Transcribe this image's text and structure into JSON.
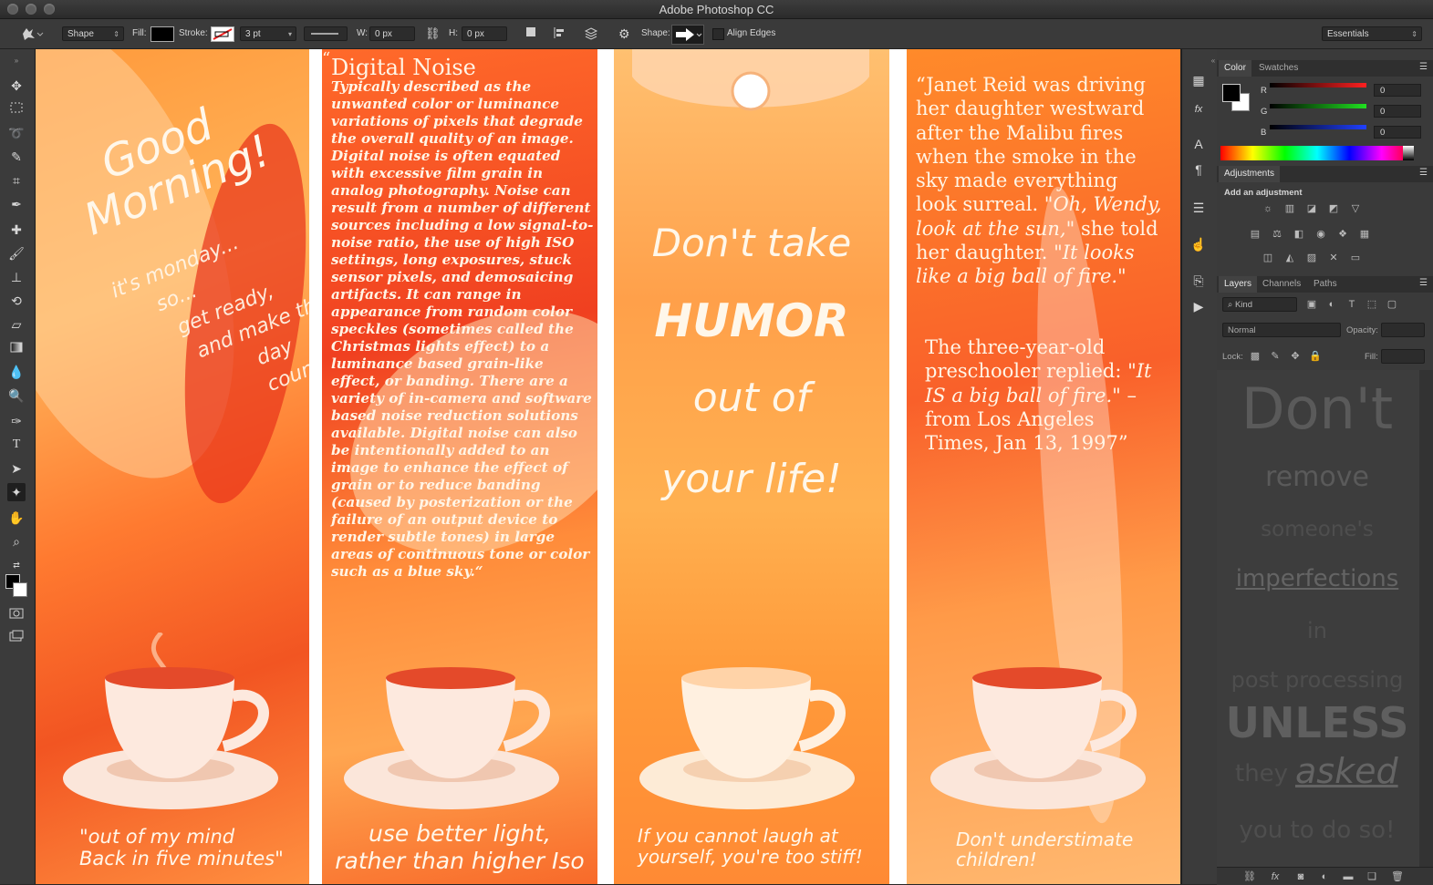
{
  "app": {
    "title": "Adobe Photoshop CC"
  },
  "options_bar": {
    "mode": "Shape",
    "fill_label": "Fill:",
    "stroke_label": "Stroke:",
    "stroke_width": "3 pt",
    "w_label": "W:",
    "w_value": "0 px",
    "h_label": "H:",
    "h_value": "0 px",
    "shape_label": "Shape:",
    "align_edges": "Align Edges",
    "workspace": "Essentials"
  },
  "canvas": {
    "panel1": {
      "line1": "Good",
      "line2": "Morning!",
      "sub1": "it's monday...",
      "sub2": "so...",
      "sub3": "get ready,",
      "sub4": "and make this",
      "sub5": "day count!",
      "quote1": "\"out of my mind",
      "quote2": "Back in five minutes\""
    },
    "panel2": {
      "open_quote": "“",
      "heading": "Digital Noise",
      "body": "Typically described as the unwanted color or luminance variations of pixels that degrade the overall quality of an image. Digital noise is often equated with excessive film grain in analog photography. Noise can result from a number of different sources including a low signal-to-noise ratio, the use of high ISO settings, long exposures, stuck sensor pixels, and demosaicing artifacts. It can range in appearance from random color speckles (sometimes called the Christmas lights effect) to a luminance based grain-like effect, or banding. There are a variety of in-camera and software based noise reduction solutions available. Digital noise can also be intentionally added to an image to enhance the effect of grain or to reduce banding (caused by posterization or the failure of an output device to render subtle tones) in large areas of continuous tone or color such as a blue sky.“",
      "footer1": "use better light,",
      "footer2": "rather than higher Iso"
    },
    "panel3": {
      "line1": "Don't take",
      "line2": "HUMOR",
      "line3": "out of",
      "line4": "your life!",
      "footer1": "If you cannot laugh at",
      "footer2": "yourself, you're too stiff!"
    },
    "panel4": {
      "para1_a": "“Janet Reid was driving her daughter westward after the Malibu fires when the smoke in the sky made everything look surreal. ",
      "para1_b": "\"Oh, Wendy, look at the sun,\"",
      "para1_c": " she told her daughter. ",
      "para1_d": "\"It looks like a big ball of fire.\"",
      "para2_a": "The three-year-old preschooler replied: ",
      "para2_b": "\"It IS a big ball of fire.\"",
      "para2_c": " – from Los Angeles Times, Jan 13, 1997”",
      "footer1": "Don't understimate",
      "footer2": "children!"
    }
  },
  "color_panel": {
    "tab_color": "Color",
    "tab_swatches": "Swatches",
    "r_label": "R",
    "g_label": "G",
    "b_label": "B",
    "r_value": "0",
    "g_value": "0",
    "b_value": "0"
  },
  "adjustments_panel": {
    "tab": "Adjustments",
    "heading": "Add an adjustment"
  },
  "layers_panel": {
    "tab_layers": "Layers",
    "tab_channels": "Channels",
    "tab_paths": "Paths",
    "kind": "Kind",
    "blend_mode": "Normal",
    "opacity_label": "Opacity:",
    "lock_label": "Lock:",
    "fill_label": "Fill:",
    "preview": {
      "w1": "Don't",
      "w2": "remove",
      "w3": "someone's",
      "w4": "imperfections",
      "w5": "in",
      "w6": "post processing",
      "w7": "UNLESS",
      "w8": "they",
      "w9": "asked",
      "w10": "you to do so!"
    }
  },
  "colors": {
    "accent_red": "#ff3b3b",
    "accent_green": "#36c236",
    "accent_blue": "#3b5bff"
  }
}
